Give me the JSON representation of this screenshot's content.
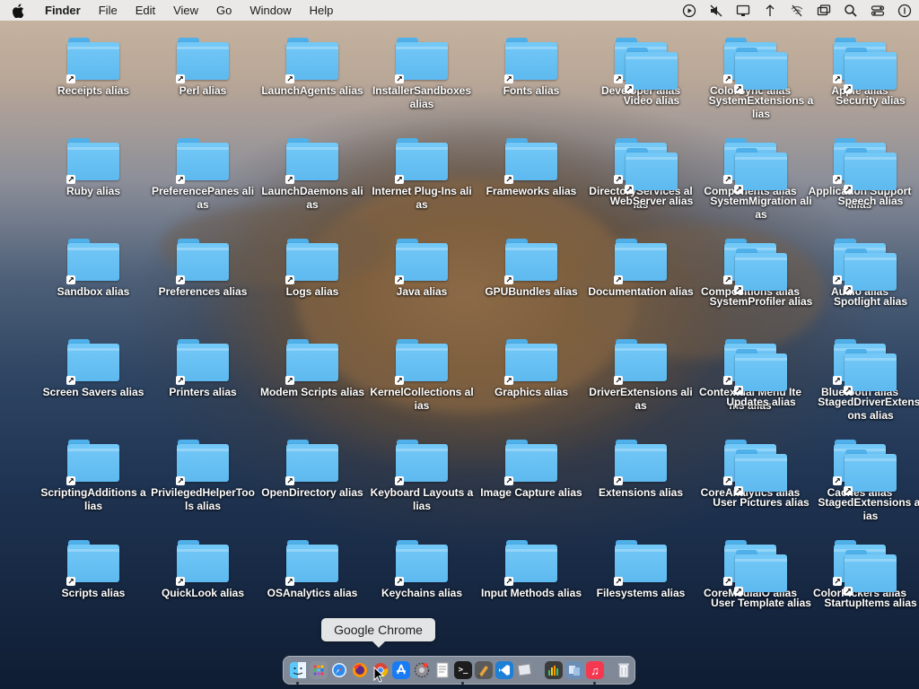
{
  "menubar": {
    "app_name": "Finder",
    "menus": [
      "File",
      "Edit",
      "View",
      "Go",
      "Window",
      "Help"
    ],
    "status_icons": [
      "play-circle-icon",
      "mute-icon",
      "display-icon",
      "airdrop-icon",
      "wifi-off-icon",
      "screen-mirror-icon",
      "search-icon",
      "control-center-icon",
      "siri-icon"
    ]
  },
  "desktop": {
    "items": [
      {
        "label": "Receipts alias"
      },
      {
        "label": "Perl alias"
      },
      {
        "label": "LaunchAgents alias"
      },
      {
        "label": "InstallerSandboxes alias"
      },
      {
        "label": "Fonts alias"
      },
      {
        "label": "Developer alias"
      },
      {
        "label": "ColorSync alias"
      },
      {
        "label": "Apple alias"
      },
      {
        "label": "Video alias"
      },
      {
        "label": "SystemExtensions alias"
      },
      {
        "label": "Security alias"
      },
      {
        "label": "Ruby alias"
      },
      {
        "label": "PreferencePanes alias"
      },
      {
        "label": "LaunchDaemons alias"
      },
      {
        "label": "Internet Plug-Ins alias"
      },
      {
        "label": "Frameworks alias"
      },
      {
        "label": "DirectoryServices alias"
      },
      {
        "label": "Components alias"
      },
      {
        "label": "Application Support alias"
      },
      {
        "label": "WebServer alias"
      },
      {
        "label": "SystemMigration alias"
      },
      {
        "label": "Speech alias"
      },
      {
        "label": "Sandbox alias"
      },
      {
        "label": "Preferences alias"
      },
      {
        "label": "Logs alias"
      },
      {
        "label": "Java alias"
      },
      {
        "label": "GPUBundles alias"
      },
      {
        "label": "Documentation alias"
      },
      {
        "label": "Compositions alias"
      },
      {
        "label": "Audio alias"
      },
      {
        "label": "SystemProfiler alias"
      },
      {
        "label": "Spotlight alias"
      },
      {
        "label": "Screen Savers alias"
      },
      {
        "label": "Printers alias"
      },
      {
        "label": "Modem Scripts alias"
      },
      {
        "label": "KernelCollections alias"
      },
      {
        "label": "Graphics alias"
      },
      {
        "label": "DriverExtensions alias"
      },
      {
        "label": "Contextual Menu Items alias"
      },
      {
        "label": "Bluetooth alias"
      },
      {
        "label": "Updates alias"
      },
      {
        "label": "StagedDriverExtensions alias"
      },
      {
        "label": "ScriptingAdditions alias"
      },
      {
        "label": "PrivilegedHelperTools alias"
      },
      {
        "label": "OpenDirectory alias"
      },
      {
        "label": "Keyboard Layouts alias"
      },
      {
        "label": "Image Capture alias"
      },
      {
        "label": "Extensions alias"
      },
      {
        "label": "CoreAnalytics alias"
      },
      {
        "label": "Caches alias"
      },
      {
        "label": "User Pictures alias"
      },
      {
        "label": "StagedExtensions alias"
      },
      {
        "label": "Scripts alias"
      },
      {
        "label": "QuickLook alias"
      },
      {
        "label": "OSAnalytics alias"
      },
      {
        "label": "Keychains alias"
      },
      {
        "label": "Input Methods alias"
      },
      {
        "label": "Filesystems alias"
      },
      {
        "label": "CoreMediaIO alias"
      },
      {
        "label": "ColorPickers alias"
      },
      {
        "label": "User Template alias"
      },
      {
        "label": "StartupItems alias"
      }
    ]
  },
  "tooltip": {
    "text": "Google Chrome"
  },
  "dock": {
    "apps": [
      {
        "name": "finder-icon",
        "color": "#2a8cf0",
        "running": true
      },
      {
        "name": "launchpad-icon",
        "color": "#8a8f9c",
        "running": false
      },
      {
        "name": "safari-icon",
        "color": "#1e90ff",
        "running": false
      },
      {
        "name": "firefox-icon",
        "color": "#e8572d",
        "running": false
      },
      {
        "name": "chrome-icon",
        "color": "#f4f4f4",
        "running": false
      },
      {
        "name": "app-store-icon",
        "color": "#1a7cf5",
        "running": false
      },
      {
        "name": "system-preferences-icon",
        "color": "#6d6d72",
        "running": false
      },
      {
        "name": "textedit-icon",
        "color": "#f5f5f0",
        "running": false
      },
      {
        "name": "terminal-icon",
        "color": "#1c1c1c",
        "running": true
      },
      {
        "name": "script-editor-icon",
        "color": "#5a5a5a",
        "running": false
      },
      {
        "name": "vscode-icon",
        "color": "#1d7fd6",
        "running": false
      },
      {
        "name": "preview-icon",
        "color": "#c9ced6",
        "running": false
      },
      {
        "name": "activity-monitor-icon",
        "color": "#3b3b3b",
        "running": false
      },
      {
        "name": "migration-assistant-icon",
        "color": "#6c8db5",
        "running": false
      },
      {
        "name": "music-icon",
        "color": "#f5374f",
        "running": true
      },
      {
        "name": "trash-icon",
        "color": "#d8dde3",
        "running": false
      }
    ]
  }
}
